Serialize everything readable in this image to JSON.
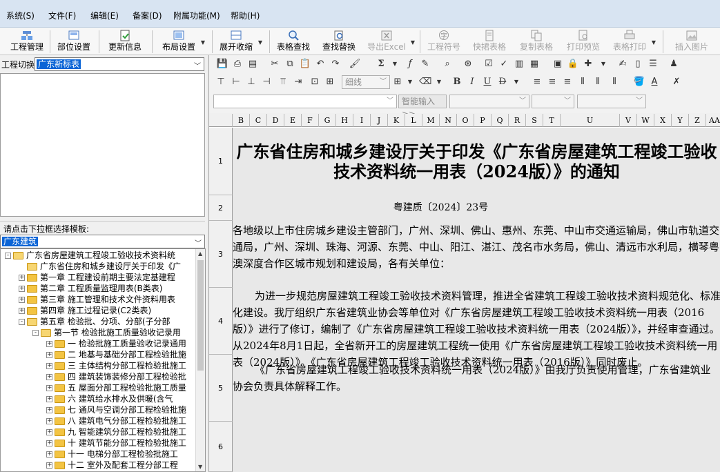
{
  "menu": [
    "系统(S)",
    "文件(F)",
    "编辑(E)",
    "备案(D)",
    "附属功能(M)",
    "帮助(H)"
  ],
  "toolbar": {
    "project_manage": "工程管理",
    "part_settings": "部位设置",
    "update_info": "更新信息",
    "layout_settings": "布局设置",
    "expand_collapse": "展开收缩",
    "find_table": "表格查找",
    "find_replace": "查找替换",
    "export_excel": "导出Excel",
    "project_symbol": "工程符号",
    "quick_table": "快捃表格",
    "copy_table": "复制表格",
    "print_preview": "打印预览",
    "table_print": "表格打印",
    "insert_image": "插入图片"
  },
  "left": {
    "project_switch_label": "工程切换",
    "project_switch_value": "广东新标表",
    "template_prompt": "请点击下拉框选择模板:",
    "template_value": "广东建筑"
  },
  "tree": [
    {
      "label": "广东省房屋建筑工程竣工验收技术资料统",
      "level": 0,
      "pm": "-",
      "open": true
    },
    {
      "label": "广东省住房和城乡建设厅关于印发《广",
      "level": 1,
      "pm": "",
      "open": true
    },
    {
      "label": "第一章 工程建设前期主要法定基建程",
      "level": 1,
      "pm": "+",
      "open": false
    },
    {
      "label": "第二章 工程质量监理用表(B类表)",
      "level": 1,
      "pm": "+",
      "open": false
    },
    {
      "label": "第三章 施工管理和技术文件资料用表",
      "level": 1,
      "pm": "+",
      "open": false
    },
    {
      "label": "第四章 施工过程记录(C2类表)",
      "level": 1,
      "pm": "+",
      "open": false
    },
    {
      "label": "第五章 检验批、分项、分部(子分部",
      "level": 1,
      "pm": "-",
      "open": true
    },
    {
      "label": "第一节 检验批施工质量验收记录用",
      "level": 2,
      "pm": "-",
      "open": true
    },
    {
      "label": "一 检验批施工质量验收记录通用",
      "level": 3,
      "pm": "+",
      "open": false
    },
    {
      "label": "二 地基与基础分部工程检验批施",
      "level": 3,
      "pm": "+",
      "open": false
    },
    {
      "label": "三 主体结构分部工程检验批施工",
      "level": 3,
      "pm": "+",
      "open": false
    },
    {
      "label": "四 建筑装饰装修分部工程检验批",
      "level": 3,
      "pm": "+",
      "open": false
    },
    {
      "label": "五 屋面分部工程检验批施工质量",
      "level": 3,
      "pm": "+",
      "open": false
    },
    {
      "label": "六 建筑给水排水及供暖(含气",
      "level": 3,
      "pm": "+",
      "open": false
    },
    {
      "label": "七 通风与空调分部工程检验批施",
      "level": 3,
      "pm": "+",
      "open": false
    },
    {
      "label": "八 建筑电气分部工程检验批施工",
      "level": 3,
      "pm": "+",
      "open": false
    },
    {
      "label": "九 智能建筑分部工程检验批施工",
      "level": 3,
      "pm": "+",
      "open": false
    },
    {
      "label": "十 建筑节能分部工程检验批施工",
      "level": 3,
      "pm": "+",
      "open": false
    },
    {
      "label": "十一 电梯分部工程检验批施工",
      "level": 3,
      "pm": "+",
      "open": false
    },
    {
      "label": "十二 室外及配套工程分部工程",
      "level": 3,
      "pm": "+",
      "open": false
    }
  ],
  "format": {
    "border_style": "细线",
    "smart_input": "智能输入>>"
  },
  "grid": {
    "columns": [
      "B",
      "C",
      "D",
      "E",
      "F",
      "G",
      "H",
      "I",
      "J",
      "K",
      "L",
      "M",
      "N",
      "O",
      "P",
      "Q",
      "R",
      "S",
      "T",
      "U",
      "V",
      "W",
      "X",
      "Y",
      "Z",
      "AA"
    ],
    "rows": [
      "1",
      "2",
      "3",
      "4",
      "5",
      "6"
    ],
    "title": "广东省住房和城乡建设厅关于印发《广东省房屋建筑工程竣工验收技术资料统一用表（2024版）》的通知",
    "doc_number": "粤建质〔2024〕23号",
    "para_addressees": "各地级以上市住房城乡建设主管部门，广州、深圳、佛山、惠州、东莞、中山市交通运输局，佛山市轨道交通局，广州、深圳、珠海、河源、东莞、中山、阳江、湛江、茂名市水务局，佛山、清远市水利局，横琴粤澳深度合作区城市规划和建设局，各有关单位：",
    "para_body": "为进一步规范房屋建筑工程竣工验收技术资料管理，推进全省建筑工程竣工验收技术资料规范化、标准化建设。我厅组织广东省建筑业协会等单位对《广东省房屋建筑工程竣工验收技术资料统一用表（2016版）》进行了修订，编制了《广东省房屋建筑工程竣工验收技术资料统一用表（2024版）》，并经审查通过。从2024年8月1日起，全省新开工的房屋建筑工程统一使用《广东省房屋建筑工程竣工验收技术资料统一用表（2024版）》。《广东省房屋建筑工程竣工验收技术资料统一用表（2016版）》同时废止。",
    "para_manage": "《广东省房屋建筑工程竣工验收技术资料统一用表（2024版）》由我厅负责使用管理，广东省建筑业协会负责具体解释工作。"
  }
}
